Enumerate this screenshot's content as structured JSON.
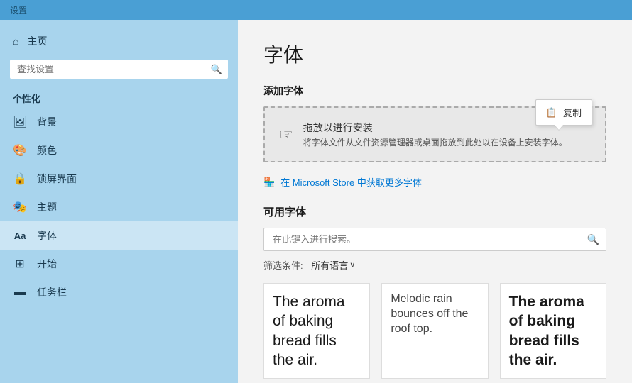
{
  "topbar": {
    "label": "设置"
  },
  "sidebar": {
    "home_label": "主页",
    "search_placeholder": "查找设置",
    "section_label": "个性化",
    "items": [
      {
        "id": "background",
        "icon": "🖼",
        "label": "背景"
      },
      {
        "id": "color",
        "icon": "🎨",
        "label": "颜色"
      },
      {
        "id": "lockscreen",
        "icon": "🔒",
        "label": "锁屏界面"
      },
      {
        "id": "theme",
        "icon": "🎭",
        "label": "主题"
      },
      {
        "id": "font",
        "icon": "Aa",
        "label": "字体",
        "active": true
      },
      {
        "id": "start",
        "icon": "⊞",
        "label": "开始"
      },
      {
        "id": "taskbar",
        "icon": "▬",
        "label": "任务栏"
      }
    ]
  },
  "main": {
    "page_title": "字体",
    "add_fonts_label": "添加字体",
    "drop_zone": {
      "icon": "☞",
      "title": "拖放以进行安装",
      "subtitle": "将字体文件从文件资源管理器或桌面拖放到此处以在设备上安装字体。"
    },
    "tooltip": {
      "icon": "📋",
      "label": "复制"
    },
    "store_link": "在 Microsoft Store 中获取更多字体",
    "available_fonts_title": "可用字体",
    "font_search_placeholder": "在此键入进行搜索。",
    "filter": {
      "label": "筛选条件:",
      "value": "所有语言",
      "chevron": "∨"
    },
    "font_previews": [
      {
        "text": "The aroma of baking bread fills the air.",
        "style": "normal",
        "size": "large"
      },
      {
        "text": "Melodic rain bounces off the roof top.",
        "style": "normal",
        "size": "normal"
      },
      {
        "text": "The aroma of baking bread fills the air.",
        "style": "bold",
        "size": "large"
      }
    ]
  }
}
